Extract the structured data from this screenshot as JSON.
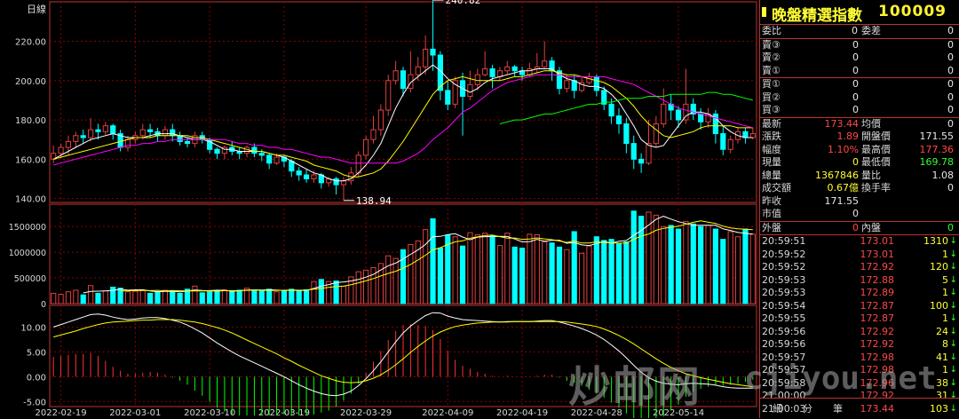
{
  "chart": {
    "period_label": "日線",
    "high_label": "240.82",
    "low_label": "138.94",
    "price_ticks": [
      "220.00",
      "200.00",
      "180.00",
      "160.00",
      "140.00"
    ],
    "volume_ticks": [
      "1500000",
      "1000000",
      "500000",
      "0"
    ],
    "macd_ticks": [
      "10.00",
      "5.00",
      "0.00",
      "-5.00"
    ],
    "dates": [
      "2022-02-19",
      "2022-03-01",
      "2022-03-10",
      "2022-03-19",
      "2022-03-29",
      "2022-04-09",
      "2022-04-19",
      "2022-04-28",
      "2022-05-14"
    ],
    "colors": {
      "up": "#e04040",
      "down": "#00ffff",
      "ma5": "#ffffff",
      "ma10": "#ffff00",
      "ma20": "#ff00ff",
      "ma60": "#00ff00",
      "ma120": "#ff9900",
      "grid": "#8b0000"
    }
  },
  "chart_data": {
    "type": "candlestick",
    "price_ylim": [
      138,
      232
    ],
    "candles": [
      [
        160,
        163,
        158,
        167
      ],
      [
        163,
        166,
        161,
        168
      ],
      [
        166,
        169,
        162,
        172
      ],
      [
        169,
        172,
        166,
        174
      ],
      [
        172,
        171,
        168,
        175
      ],
      [
        171,
        175,
        169,
        181
      ],
      [
        175,
        174,
        170,
        178
      ],
      [
        174,
        177,
        172,
        179
      ],
      [
        177,
        173,
        170,
        178
      ],
      [
        173,
        166,
        164,
        175
      ],
      [
        166,
        170,
        164,
        172
      ],
      [
        170,
        172,
        168,
        174
      ],
      [
        172,
        175,
        170,
        178
      ],
      [
        175,
        174,
        171,
        178
      ],
      [
        174,
        172,
        169,
        176
      ],
      [
        172,
        175,
        170,
        177
      ],
      [
        175,
        172,
        169,
        178
      ],
      [
        172,
        169,
        167,
        174
      ],
      [
        169,
        168,
        166,
        171
      ],
      [
        168,
        172,
        166,
        174
      ],
      [
        172,
        170,
        168,
        174
      ],
      [
        170,
        165,
        163,
        171
      ],
      [
        165,
        163,
        160,
        166
      ],
      [
        163,
        166,
        160,
        167
      ],
      [
        166,
        164,
        162,
        169
      ],
      [
        164,
        163,
        160,
        166
      ],
      [
        163,
        166,
        161,
        167
      ],
      [
        166,
        163,
        161,
        168
      ],
      [
        163,
        162,
        159,
        165
      ],
      [
        162,
        158,
        155,
        163
      ],
      [
        158,
        161,
        157,
        163
      ],
      [
        161,
        159,
        156,
        162
      ],
      [
        159,
        154,
        151,
        160
      ],
      [
        154,
        152,
        149,
        156
      ],
      [
        152,
        150,
        148,
        155
      ],
      [
        150,
        152,
        148,
        154
      ],
      [
        152,
        148,
        145,
        153
      ],
      [
        148,
        150,
        146,
        151
      ],
      [
        150,
        147,
        142,
        151
      ],
      [
        147,
        149,
        139,
        151
      ],
      [
        149,
        153,
        147,
        156
      ],
      [
        153,
        162,
        151,
        164
      ],
      [
        162,
        170,
        160,
        172
      ],
      [
        170,
        175,
        168,
        182
      ],
      [
        175,
        185,
        172,
        188
      ],
      [
        185,
        200,
        182,
        203
      ],
      [
        200,
        205,
        198,
        210
      ],
      [
        205,
        196,
        192,
        207
      ],
      [
        196,
        203,
        194,
        215
      ],
      [
        203,
        207,
        200,
        212
      ],
      [
        207,
        216,
        203,
        223
      ],
      [
        216,
        213,
        205,
        241
      ],
      [
        213,
        195,
        190,
        215
      ],
      [
        195,
        188,
        185,
        200
      ],
      [
        188,
        200,
        186,
        202
      ],
      [
        200,
        192,
        172,
        204
      ],
      [
        192,
        198,
        190,
        205
      ],
      [
        198,
        203,
        195,
        206
      ],
      [
        203,
        206,
        202,
        215
      ],
      [
        206,
        202,
        196,
        208
      ],
      [
        202,
        205,
        200,
        207
      ],
      [
        205,
        207,
        203,
        210
      ],
      [
        207,
        205,
        202,
        208
      ],
      [
        205,
        203,
        200,
        207
      ],
      [
        203,
        206,
        202,
        209
      ],
      [
        206,
        207,
        204,
        214
      ],
      [
        207,
        210,
        206,
        220
      ],
      [
        210,
        205,
        200,
        212
      ],
      [
        205,
        196,
        193,
        207
      ],
      [
        196,
        200,
        194,
        203
      ],
      [
        200,
        195,
        191,
        203
      ],
      [
        195,
        199,
        194,
        202
      ],
      [
        199,
        202,
        198,
        204
      ],
      [
        202,
        195,
        192,
        203
      ],
      [
        195,
        188,
        185,
        197
      ],
      [
        188,
        182,
        178,
        191
      ],
      [
        182,
        178,
        173,
        186
      ],
      [
        178,
        168,
        163,
        181
      ],
      [
        168,
        160,
        155,
        172
      ],
      [
        160,
        158,
        153,
        163
      ],
      [
        158,
        168,
        157,
        180
      ],
      [
        168,
        178,
        166,
        182
      ],
      [
        178,
        188,
        176,
        196
      ],
      [
        188,
        185,
        180,
        193
      ],
      [
        185,
        180,
        176,
        187
      ],
      [
        180,
        188,
        178,
        206
      ],
      [
        188,
        183,
        180,
        191
      ],
      [
        183,
        179,
        175,
        186
      ],
      [
        179,
        183,
        176,
        186
      ],
      [
        183,
        173,
        168,
        185
      ],
      [
        173,
        165,
        162,
        177
      ],
      [
        165,
        170,
        163,
        172
      ],
      [
        170,
        174,
        168,
        176
      ],
      [
        174,
        171,
        168,
        176
      ],
      [
        171,
        173,
        170,
        176
      ]
    ],
    "volumes_k": [
      200,
      180,
      230,
      260,
      170,
      350,
      200,
      250,
      320,
      300,
      230,
      240,
      260,
      200,
      230,
      260,
      250,
      200,
      280,
      340,
      210,
      230,
      240,
      270,
      250,
      260,
      300,
      260,
      250,
      280,
      230,
      250,
      280,
      250,
      270,
      430,
      470,
      430,
      440,
      340,
      520,
      620,
      650,
      700,
      780,
      930,
      880,
      1050,
      1150,
      1220,
      1440,
      1650,
      1080,
      1330,
      1300,
      1120,
      1380,
      1340,
      1370,
      1320,
      1130,
      1370,
      1100,
      1080,
      1350,
      1340,
      1200,
      1180,
      1100,
      1050,
      1400,
      980,
      1120,
      1300,
      1230,
      1250,
      1160,
      1200,
      1800,
      1700,
      1780,
      1720,
      1500,
      1520,
      1450,
      1600,
      1550,
      1500,
      1520,
      1450,
      1250,
      1400,
      1300,
      1450,
      1350
    ],
    "ma5": [
      160,
      162,
      164,
      166,
      168,
      170,
      171,
      172,
      173,
      172,
      171,
      171,
      171,
      172,
      173,
      173,
      173,
      172,
      171,
      170,
      170,
      169,
      167,
      165,
      165,
      164,
      164,
      164,
      164,
      163,
      162,
      161,
      159,
      157,
      155,
      153,
      152,
      150,
      149,
      149,
      150,
      153,
      157,
      162,
      168,
      177,
      186,
      193,
      199,
      202,
      205,
      208,
      205,
      201,
      198,
      196,
      194,
      196,
      199,
      201,
      202,
      203,
      204,
      205,
      205,
      206,
      206,
      206,
      203,
      201,
      200,
      198,
      197,
      197,
      196,
      193,
      189,
      183,
      177,
      170,
      167,
      166,
      167,
      172,
      177,
      182,
      184,
      184,
      183,
      181,
      177,
      174,
      172,
      171,
      171
    ],
    "ma10": [
      160,
      161,
      162,
      163,
      164,
      165,
      166,
      167,
      168,
      169,
      170,
      171,
      171,
      171,
      172,
      172,
      172,
      172,
      172,
      171,
      171,
      170,
      169,
      168,
      167,
      166,
      165,
      164,
      164,
      163,
      162,
      162,
      161,
      160,
      159,
      157,
      156,
      155,
      154,
      152,
      151,
      151,
      152,
      153,
      155,
      159,
      164,
      169,
      175,
      181,
      187,
      193,
      197,
      200,
      201,
      202,
      201,
      200,
      200,
      200,
      200,
      201,
      202,
      202,
      203,
      204,
      205,
      205,
      204,
      203,
      203,
      202,
      201,
      200,
      199,
      197,
      194,
      191,
      187,
      182,
      178,
      175,
      172,
      171,
      172,
      173,
      174,
      176,
      177,
      177,
      177,
      177,
      176,
      176,
      176
    ],
    "ma20": [
      157,
      158,
      159,
      160,
      161,
      162,
      163,
      164,
      165,
      166,
      167,
      167,
      168,
      168,
      169,
      169,
      170,
      170,
      170,
      170,
      170,
      170,
      170,
      170,
      169,
      168,
      168,
      167,
      167,
      166,
      166,
      165,
      165,
      164,
      163,
      162,
      161,
      161,
      160,
      159,
      158,
      158,
      158,
      158,
      158,
      158,
      158,
      159,
      161,
      163,
      166,
      170,
      173,
      176,
      180,
      184,
      186,
      189,
      192,
      195,
      197,
      199,
      200,
      201,
      202,
      203,
      203,
      203,
      203,
      202,
      202,
      202,
      202,
      202,
      202,
      201,
      200,
      199,
      198,
      196,
      194,
      192,
      190,
      188,
      186,
      185,
      184,
      183,
      182,
      181,
      180,
      179,
      178,
      177,
      176
    ],
    "ma60": [
      null,
      null,
      null,
      null,
      null,
      null,
      null,
      null,
      null,
      null,
      null,
      null,
      null,
      null,
      null,
      null,
      null,
      null,
      null,
      null,
      null,
      null,
      null,
      null,
      null,
      null,
      null,
      null,
      null,
      null,
      null,
      null,
      null,
      null,
      null,
      null,
      null,
      null,
      null,
      null,
      null,
      null,
      null,
      null,
      null,
      null,
      null,
      null,
      null,
      null,
      null,
      null,
      null,
      null,
      null,
      null,
      null,
      null,
      null,
      null,
      178,
      179,
      180,
      180,
      181,
      182,
      183,
      183,
      184,
      185,
      186,
      187,
      188,
      188,
      189,
      189,
      190,
      191,
      191,
      191,
      192,
      192,
      192,
      193,
      193,
      193,
      193,
      193,
      194,
      194,
      193,
      193,
      192,
      191,
      190
    ],
    "ma120": [
      null,
      null,
      null,
      null,
      null,
      null,
      null,
      null,
      null,
      null,
      null,
      null,
      null,
      null,
      null,
      null,
      null,
      null,
      null,
      null,
      null,
      null,
      null,
      null,
      null,
      null,
      null,
      null,
      null,
      null,
      null,
      null,
      null,
      null,
      null,
      null,
      null,
      null,
      null,
      null,
      null,
      null,
      null,
      null,
      null,
      null,
      null,
      null,
      null,
      null,
      null,
      null,
      null,
      null,
      null,
      null,
      null,
      null,
      null,
      null,
      null,
      null,
      null,
      null,
      null,
      null,
      null,
      null,
      null,
      null,
      null,
      null,
      null,
      null,
      null,
      null,
      null,
      null,
      null,
      null,
      null,
      null,
      null,
      null,
      null,
      null,
      null,
      null,
      null,
      null,
      null,
      null,
      null,
      null,
      null
    ]
  },
  "macd": {
    "ylim": [
      -6,
      14
    ],
    "dif": [
      10,
      10.5,
      11,
      11.5,
      12,
      12.5,
      12.6,
      12.4,
      12,
      11.7,
      11.5,
      11.6,
      11.8,
      11.9,
      11.9,
      11.7,
      11.4,
      11,
      10.4,
      9.6,
      8.8,
      7.8,
      6.8,
      5.9,
      5,
      4.2,
      3.5,
      2.8,
      2.1,
      1.4,
      0.7,
      0,
      -0.8,
      -1.6,
      -2.3,
      -2.9,
      -3.4,
      -3.7,
      -3.8,
      -3.5,
      -2.9,
      -1.8,
      -0.4,
      1.2,
      3,
      5,
      7,
      8.8,
      10.2,
      11.3,
      12.3,
      12.9,
      12.8,
      12.2,
      11.8,
      11.5,
      11.4,
      11.3,
      11.2,
      11.1,
      11,
      11.1,
      11.1,
      11.1,
      11.1,
      11.2,
      11.3,
      11.3,
      11,
      10.6,
      10.2,
      9.7,
      9.1,
      8.4,
      7.5,
      6.4,
      5.2,
      3.8,
      2.3,
      0.9,
      -0.2,
      -0.9,
      -1.3,
      -1.5,
      -1.6,
      -1.4,
      -1.3,
      -1.4,
      -1.5,
      -1.7,
      -2,
      -2.2,
      -2.3,
      -2.3,
      -2.3
    ],
    "dea": [
      8,
      8.4,
      8.8,
      9.2,
      9.7,
      10.1,
      10.5,
      10.8,
      11,
      11.1,
      11.2,
      11.3,
      11.4,
      11.4,
      11.5,
      11.5,
      11.5,
      11.4,
      11.2,
      11,
      10.7,
      10.3,
      9.9,
      9.4,
      8.8,
      8.1,
      7.4,
      6.7,
      6,
      5.3,
      4.6,
      3.8,
      3.1,
      2.3,
      1.6,
      0.9,
      0.2,
      -0.3,
      -0.8,
      -1.1,
      -1.2,
      -1.1,
      -0.8,
      -0.3,
      0.4,
      1.3,
      2.4,
      3.6,
      4.9,
      6.1,
      7.2,
      8.2,
      9,
      9.6,
      10.1,
      10.4,
      10.6,
      10.8,
      10.9,
      11,
      11,
      11,
      11.1,
      11.1,
      11.1,
      11.1,
      11.1,
      11.1,
      11.1,
      11,
      10.8,
      10.6,
      10.4,
      10.1,
      9.6,
      9,
      8.3,
      7.5,
      6.6,
      5.6,
      4.6,
      3.6,
      2.7,
      1.9,
      1.2,
      0.6,
      0.2,
      -0.2,
      -0.5,
      -0.8,
      -1.1,
      -1.4,
      -1.6,
      -1.8,
      -2
    ]
  },
  "quote": {
    "name": "晚盤精選指數",
    "code": "100009",
    "weibi_label": "委比",
    "weibi": "0",
    "weicha_label": "委差",
    "weicha": "0",
    "sells": [
      {
        "label": "賣③",
        "price": "0",
        "vol": "0"
      },
      {
        "label": "賣②",
        "price": "0",
        "vol": "0"
      },
      {
        "label": "賣①",
        "price": "0",
        "vol": "0"
      }
    ],
    "buys": [
      {
        "label": "買①",
        "price": "0",
        "vol": "0"
      },
      {
        "label": "買②",
        "price": "0",
        "vol": "0"
      },
      {
        "label": "買③",
        "price": "0",
        "vol": "0"
      }
    ],
    "stats": {
      "latest_label": "最新",
      "latest": "173.44",
      "avg_label": "均價",
      "avg": "0",
      "change_label": "漲跌",
      "change": "1.89",
      "open_label": "開盤價",
      "open": "171.55",
      "pct_label": "幅度",
      "pct": "1.10%",
      "high_label": "最高價",
      "high": "177.36",
      "cur_vol_label": "現量",
      "cur_vol": "0",
      "low_label": "最低價",
      "low": "169.78",
      "total_vol_label": "總量",
      "total_vol": "1367846",
      "vol_ratio_label": "量比",
      "vol_ratio": "1.08",
      "amount_label": "成交額",
      "amount": "0.67億",
      "turnover_label": "換手率",
      "turnover": "0",
      "prev_label": "昨收",
      "prev": "171.55",
      "mktval_label": "市值",
      "mktval": "0"
    },
    "outer_label": "外盤",
    "outer": "0",
    "inner_label": "內盤",
    "inner": "0",
    "ticks": [
      {
        "t": "20:59:51",
        "p": "173.01",
        "v": "1310"
      },
      {
        "t": "20:59:52",
        "p": "173.01",
        "v": "1"
      },
      {
        "t": "20:59:52",
        "p": "172.92",
        "v": "120"
      },
      {
        "t": "20:59:53",
        "p": "172.88",
        "v": "5"
      },
      {
        "t": "20:59:53",
        "p": "172.89",
        "v": "1"
      },
      {
        "t": "20:59:54",
        "p": "172.87",
        "v": "100"
      },
      {
        "t": "20:59:55",
        "p": "172.87",
        "v": "1"
      },
      {
        "t": "20:59:56",
        "p": "172.92",
        "v": "24"
      },
      {
        "t": "20:59:56",
        "p": "172.92",
        "v": "8"
      },
      {
        "t": "20:59:57",
        "p": "172.98",
        "v": "41"
      },
      {
        "t": "20:59:57",
        "p": "172.98",
        "v": "1"
      },
      {
        "t": "20:59:58",
        "p": "172.96",
        "v": "38"
      },
      {
        "t": "21:00:00",
        "p": "172.92",
        "v": "31"
      },
      {
        "t": "21:00:03",
        "p": "173.44",
        "v": "103"
      }
    ],
    "tabs": [
      "細",
      "分",
      "筆"
    ]
  },
  "watermark": {
    "cn": "炒邮网",
    "url": "cjiyou.net"
  }
}
